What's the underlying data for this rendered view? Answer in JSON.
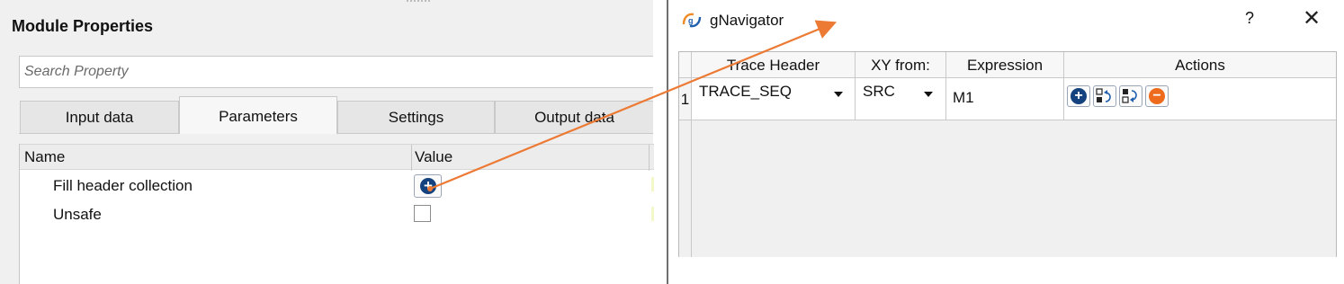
{
  "module_properties": {
    "title": "Module Properties",
    "search": {
      "placeholder": "Search Property",
      "value": ""
    },
    "tabs": [
      {
        "label": "Input data",
        "active": false
      },
      {
        "label": "Parameters",
        "active": true
      },
      {
        "label": "Settings",
        "active": false
      },
      {
        "label": "Output data",
        "active": false
      }
    ],
    "table": {
      "headers": {
        "name": "Name",
        "value": "Value"
      },
      "rows": [
        {
          "name": "Fill header collection",
          "value_type": "add-button",
          "value_icon": "plus-circle-icon"
        },
        {
          "name": "Unsafe",
          "value_type": "checkbox",
          "checked": false
        }
      ]
    }
  },
  "gnavigator": {
    "title": "gNavigator",
    "help_label": "?",
    "close_label": "✕",
    "columns": [
      "Trace Header",
      "XY from:",
      "Expression",
      "Actions"
    ],
    "rows": [
      {
        "index": "1",
        "trace_header": "TRACE_SEQ",
        "xy_from": "SRC",
        "expression": "M1",
        "actions": [
          "add-icon",
          "move-up-icon",
          "move-down-icon",
          "remove-icon"
        ]
      }
    ]
  },
  "colors": {
    "add_blue": "#14427e",
    "remove_orange": "#ee6a1d",
    "arrow_orange": "#ec7a34",
    "logo_orange": "#f08a24",
    "logo_blue": "#1f5fae"
  }
}
